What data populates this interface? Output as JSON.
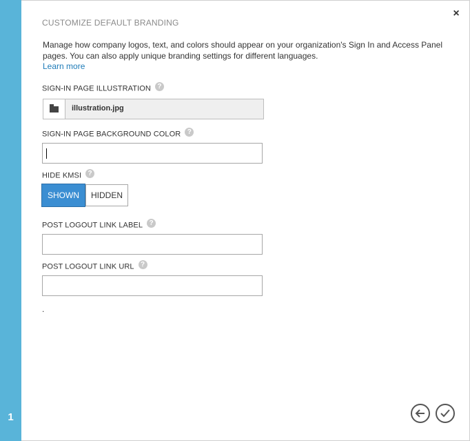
{
  "step": {
    "number": "1"
  },
  "dialog": {
    "title": "CUSTOMIZE DEFAULT BRANDING",
    "description": "Manage how company logos, text, and colors should appear on your organization's Sign In and Access Panel pages. You can also apply unique branding settings for different languages.",
    "learn_more": "Learn more",
    "close_glyph": "×"
  },
  "fields": {
    "illustration": {
      "label": "SIGN-IN PAGE ILLUSTRATION",
      "filename": "illustration.jpg"
    },
    "background_color": {
      "label": "SIGN-IN PAGE BACKGROUND COLOR",
      "value": ""
    },
    "hide_kmsi": {
      "label": "HIDE KMSI",
      "options": [
        "SHOWN",
        "HIDDEN"
      ],
      "selected": "SHOWN"
    },
    "post_logout_label": {
      "label": "POST LOGOUT LINK LABEL",
      "value": ""
    },
    "post_logout_url": {
      "label": "POST LOGOUT LINK URL",
      "value": ""
    }
  },
  "footer": {
    "stray_text": "."
  },
  "help_glyph": "?",
  "colors": {
    "accent": "#59b4d9",
    "toggle_on": "#3b8ed2",
    "link": "#1e7bb8"
  }
}
